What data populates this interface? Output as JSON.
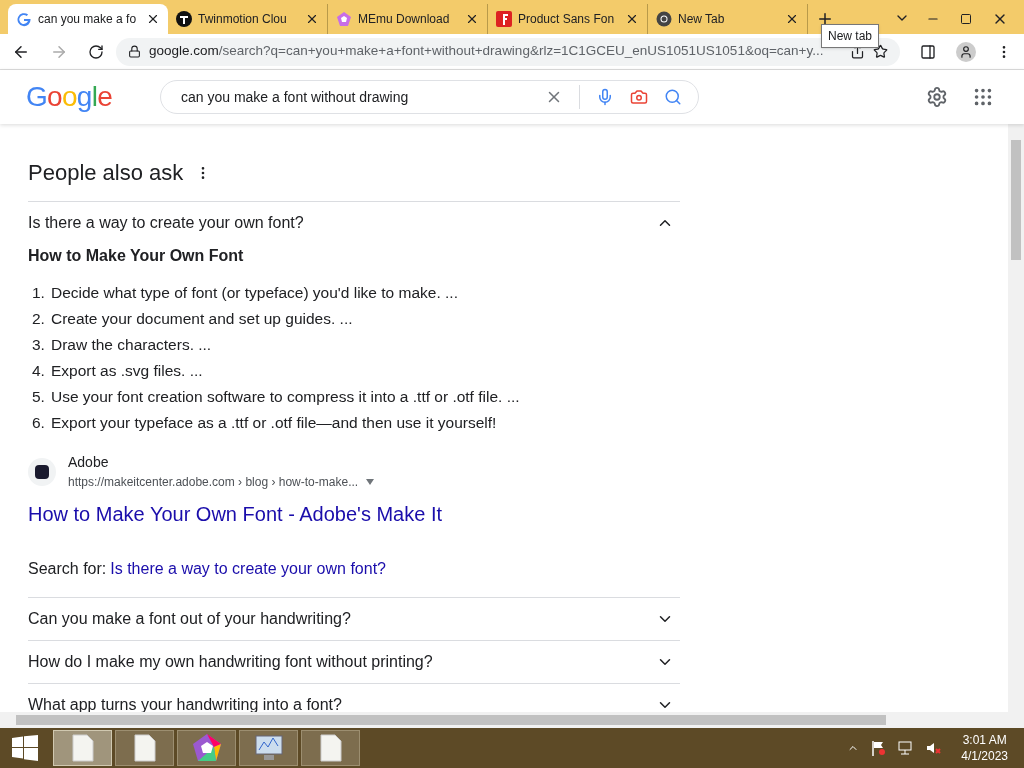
{
  "tabs": [
    {
      "title": "can you make a fo",
      "selected": true,
      "kind": "google"
    },
    {
      "title": "Twinmotion Clou",
      "selected": false,
      "kind": "twinmotion"
    },
    {
      "title": "MEmu Download",
      "selected": false,
      "kind": "memu"
    },
    {
      "title": "Product Sans Fon",
      "selected": false,
      "kind": "font"
    },
    {
      "title": "New Tab",
      "selected": false,
      "kind": "chrome"
    }
  ],
  "tooltip": "New tab",
  "address": {
    "host": "google.com",
    "path": "/search?q=can+you+make+a+font+without+drawing&rlz=1C1GCEU_enUS1051US1051&oq=can+y..."
  },
  "logo": "Google",
  "search": {
    "value": "can you make a font without drawing"
  },
  "people_also_ask": {
    "heading": "People also ask",
    "questions": [
      {
        "text": "Is there a way to create your own font?",
        "expanded": true,
        "answer": {
          "title": "How to Make Your Own Font",
          "steps": [
            {
              "number": "1.",
              "text": "Decide what type of font (or typeface) you'd like to make. ..."
            },
            {
              "number": "2.",
              "text": "Create your document and set up guides. ..."
            },
            {
              "number": "3.",
              "text": "Draw the characters. ..."
            },
            {
              "number": "4.",
              "text": "Export as .svg files. ..."
            },
            {
              "number": "5.",
              "text": "Use your font creation software to compress it into a .ttf or .otf file. ..."
            },
            {
              "number": "6.",
              "text": "Export your typeface as a .ttf or .otf file—and then use it yourself!"
            }
          ],
          "source": "Adobe",
          "url": "https://makeitcenter.adobe.com › blog › how-to-make...",
          "link": "How to Make Your Own Font - Adobe's Make It",
          "search_for_label": "Search for:",
          "search_for_link": "Is there a way to create your own font?"
        }
      },
      {
        "text": "Can you make a font out of your handwriting?",
        "expanded": false
      },
      {
        "text": "How do I make my own handwriting font without printing?",
        "expanded": false
      },
      {
        "text": "What app turns your handwriting into a font?",
        "expanded": false
      }
    ]
  },
  "taskbar": {
    "apps": [
      {
        "kind": "file",
        "selected": true
      },
      {
        "kind": "file",
        "selected": false
      },
      {
        "kind": "memu",
        "selected": false
      },
      {
        "kind": "monitor",
        "selected": false
      },
      {
        "kind": "file",
        "selected": false
      }
    ],
    "time": "3:01 AM",
    "date": "4/1/2023"
  }
}
